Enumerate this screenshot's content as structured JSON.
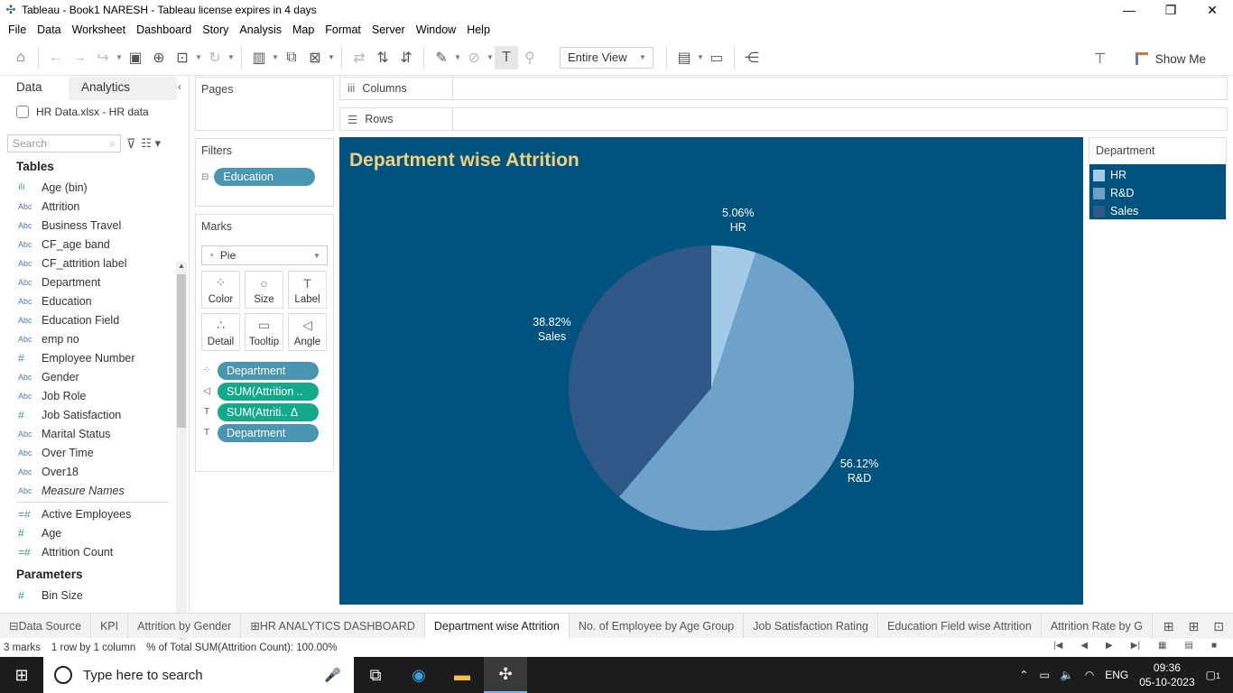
{
  "window": {
    "title": "Tableau - Book1 NARESH - Tableau license expires in 4 days",
    "minimize": "—",
    "restore": "❐",
    "close": "✕"
  },
  "menu": [
    "File",
    "Data",
    "Worksheet",
    "Dashboard",
    "Story",
    "Analysis",
    "Map",
    "Format",
    "Server",
    "Window",
    "Help"
  ],
  "toolbar": {
    "view_select": "Entire View",
    "show_me": "Show Me"
  },
  "data_pane": {
    "tabs": [
      "Data",
      "Analytics"
    ],
    "source": "HR Data.xlsx - HR data",
    "search_placeholder": "Search",
    "tables_heading": "Tables",
    "fields": [
      {
        "type": "hist",
        "name": "Age (bin)"
      },
      {
        "type": "Abc",
        "name": "Attrition"
      },
      {
        "type": "Abc",
        "name": "Business Travel"
      },
      {
        "type": "Abc",
        "name": "CF_age band"
      },
      {
        "type": "Abc",
        "name": "CF_attrition label"
      },
      {
        "type": "Abc",
        "name": "Department"
      },
      {
        "type": "Abc",
        "name": "Education"
      },
      {
        "type": "Abc",
        "name": "Education Field"
      },
      {
        "type": "Abc",
        "name": "emp no"
      },
      {
        "type": "#",
        "name": "Employee Number"
      },
      {
        "type": "Abc",
        "name": "Gender"
      },
      {
        "type": "Abc",
        "name": "Job Role"
      },
      {
        "type": "#",
        "name": "Job Satisfaction"
      },
      {
        "type": "Abc",
        "name": "Marital Status"
      },
      {
        "type": "Abc",
        "name": "Over Time"
      },
      {
        "type": "Abc",
        "name": "Over18"
      },
      {
        "type": "Abc",
        "name": "Measure Names"
      }
    ],
    "measures": [
      {
        "type": "=#",
        "name": "Active Employees"
      },
      {
        "type": "#",
        "name": "Age"
      },
      {
        "type": "=#",
        "name": "Attrition Count"
      }
    ],
    "parameters_heading": "Parameters",
    "parameters": [
      {
        "type": "#",
        "name": "Bin Size"
      }
    ]
  },
  "pages": {
    "title": "Pages"
  },
  "filters": {
    "title": "Filters",
    "items": [
      "Education"
    ]
  },
  "marks": {
    "title": "Marks",
    "type": "Pie",
    "buttons": [
      "Color",
      "Size",
      "Label",
      "Detail",
      "Tooltip",
      "Angle"
    ],
    "fields": [
      {
        "icon": "color",
        "label": "Department",
        "kind": "dimension"
      },
      {
        "icon": "angle",
        "label": "SUM(Attrition ..",
        "kind": "measure"
      },
      {
        "icon": "label",
        "label": "SUM(Attriti..  Δ",
        "kind": "measure"
      },
      {
        "icon": "label",
        "label": "Department",
        "kind": "dimension"
      }
    ]
  },
  "shelves": {
    "columns": "Columns",
    "rows": "Rows"
  },
  "viz": {
    "title": "Department wise Attrition"
  },
  "chart_data": {
    "type": "pie",
    "title": "Department wise Attrition",
    "categories": [
      "HR",
      "R&D",
      "Sales"
    ],
    "values": [
      5.06,
      56.12,
      38.82
    ],
    "labels": [
      "5.06%",
      "56.12%",
      "38.82%"
    ],
    "colors": [
      "#a3cbe8",
      "#6fa2c8",
      "#2f5788"
    ],
    "legend": "right"
  },
  "legend": {
    "title": "Department",
    "items": [
      {
        "label": "HR",
        "color": "#a3cbe8"
      },
      {
        "label": "R&D",
        "color": "#6fa2c8"
      },
      {
        "label": "Sales",
        "color": "#2f5788"
      }
    ]
  },
  "sheet_tabs": [
    {
      "label": "Data Source",
      "active": false
    },
    {
      "label": "KPI",
      "active": false
    },
    {
      "label": "Attrition by Gender",
      "active": false
    },
    {
      "label": "HR ANALYTICS DASHBOARD",
      "active": false
    },
    {
      "label": "Department wise Attrition",
      "active": true
    },
    {
      "label": "No. of Employee by Age Group",
      "active": false
    },
    {
      "label": "Job Satisfaction Rating",
      "active": false
    },
    {
      "label": "Education Field wise Attrition",
      "active": false
    },
    {
      "label": "Attrition Rate by G",
      "active": false
    }
  ],
  "status": {
    "marks": "3 marks",
    "layout": "1 row by 1 column",
    "measure": "% of Total SUM(Attrition Count): 100.00%"
  },
  "taskbar": {
    "search": "Type here to search",
    "lang": "ENG",
    "time": "09:36",
    "date": "05-10-2023",
    "notifications": "1"
  }
}
